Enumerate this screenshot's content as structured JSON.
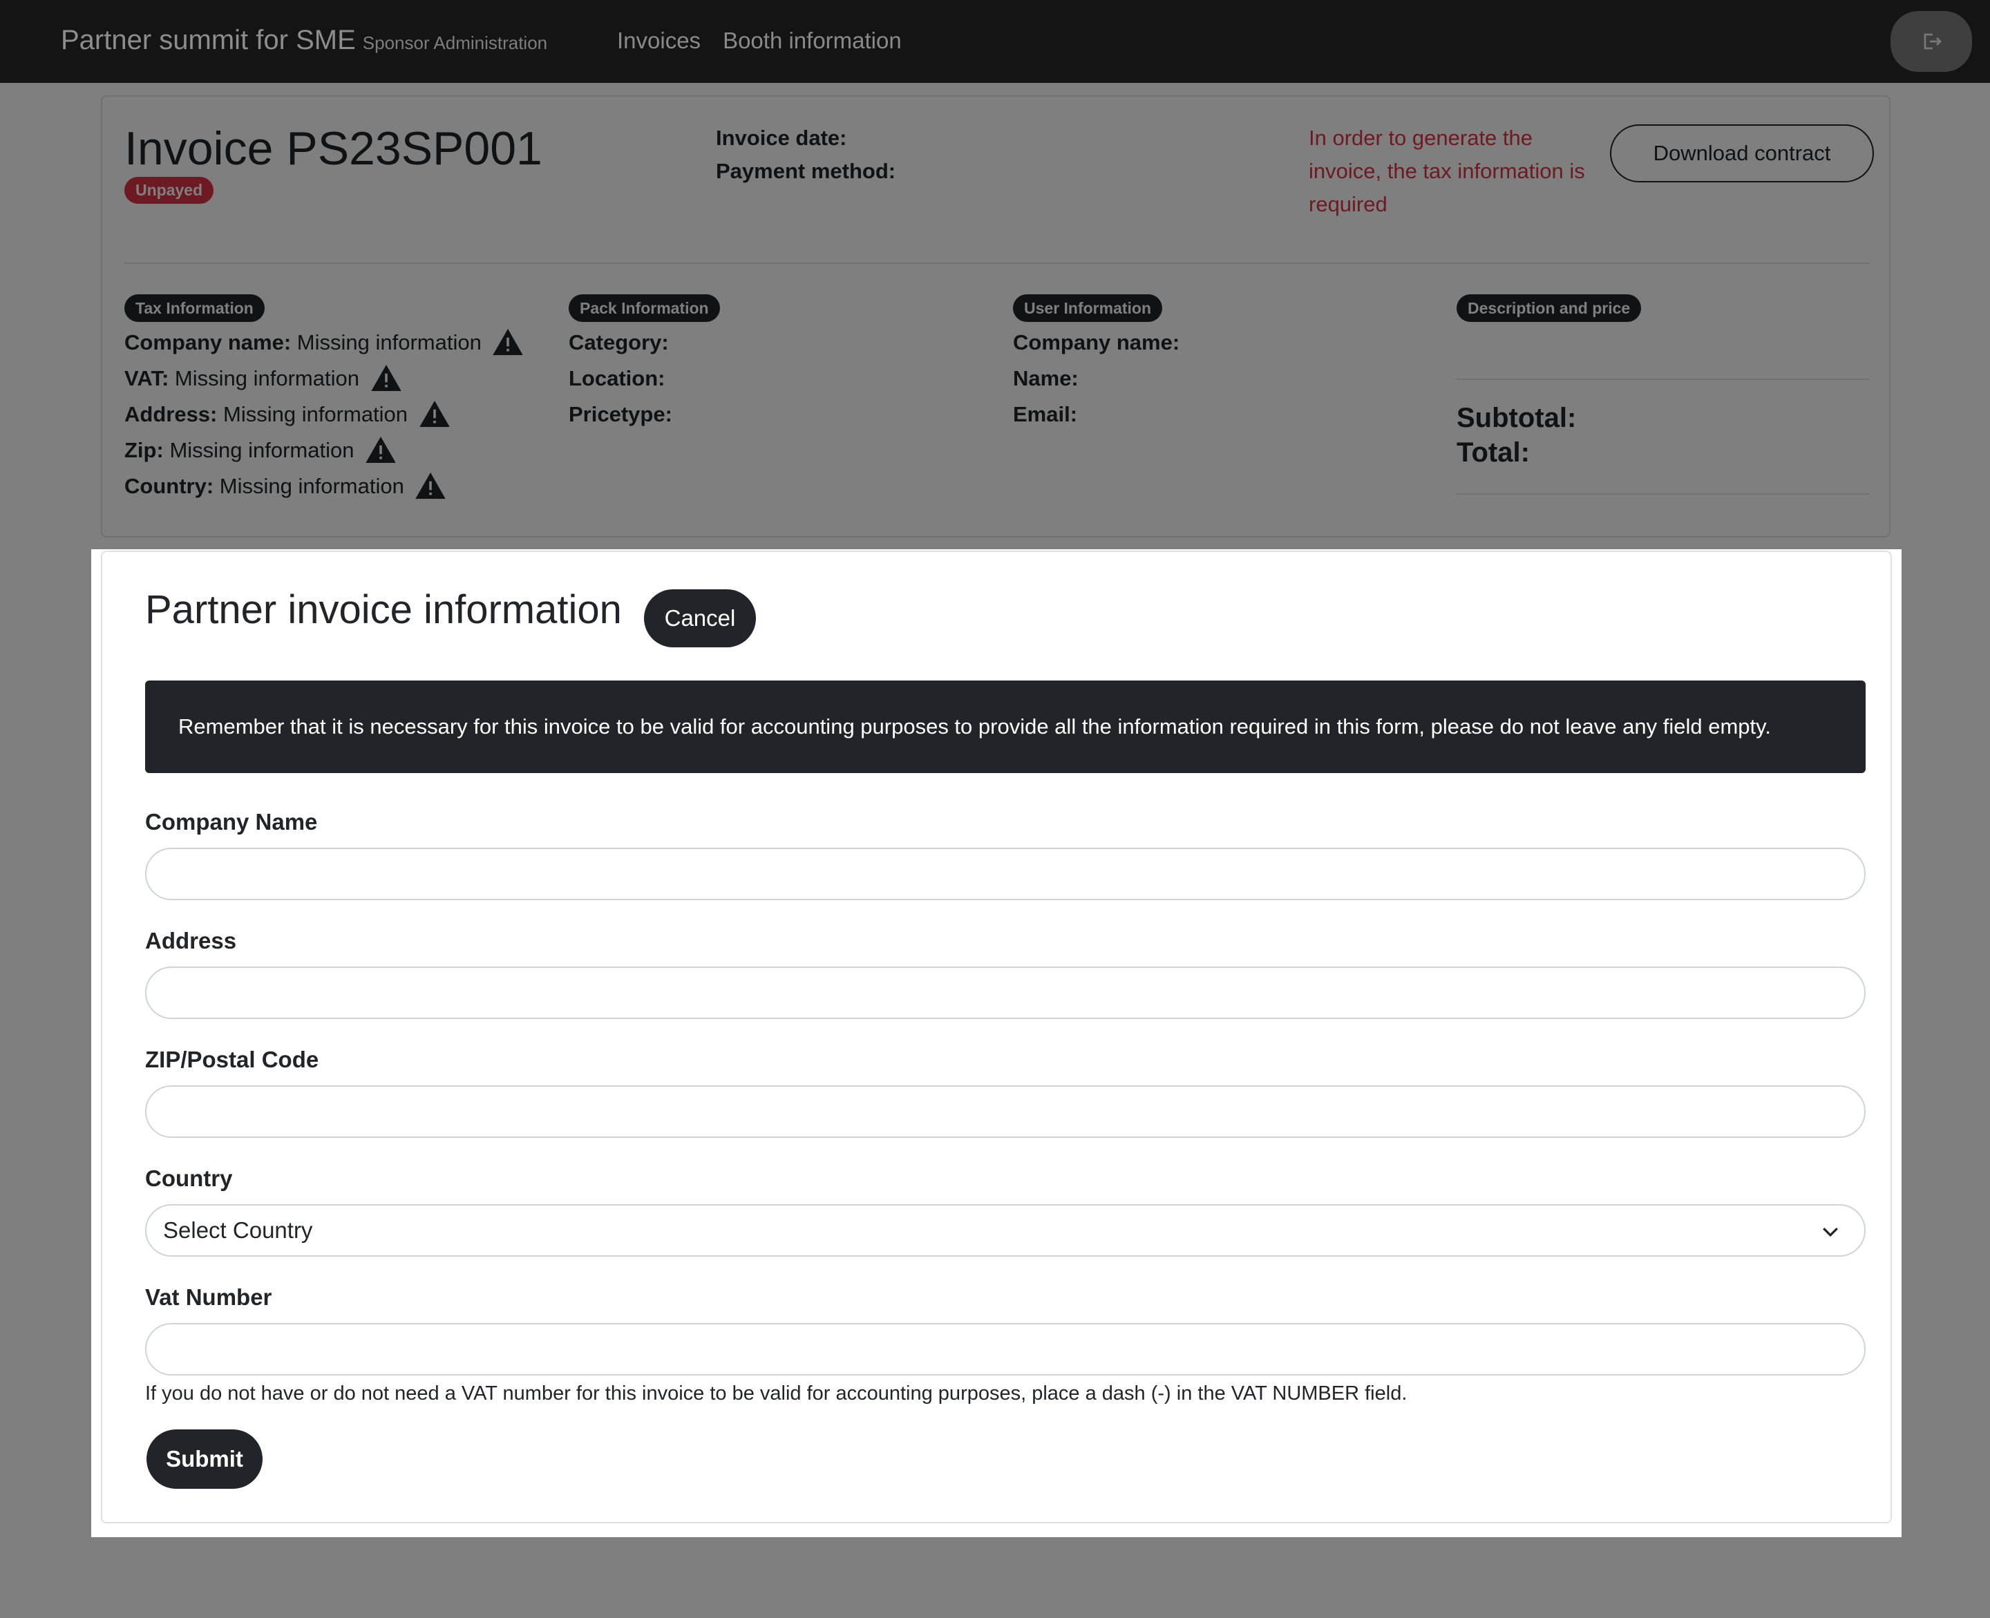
{
  "navbar": {
    "brand_title": "Partner summit for SME",
    "brand_subtitle": "Sponsor Administration",
    "links": [
      "Invoices",
      "Booth information"
    ],
    "logout_icon": "logout-icon"
  },
  "invoice": {
    "title": "Invoice PS23SP001",
    "status": "Unpayed",
    "invoice_date_label": "Invoice date:",
    "payment_method_label": "Payment method:",
    "warning": "In order to generate the invoice, the tax information is required",
    "download_label": "Download contract",
    "tax": {
      "badge": "Tax Information",
      "rows": [
        {
          "label": "Company name:",
          "value": "Missing information"
        },
        {
          "label": "VAT:",
          "value": "Missing information"
        },
        {
          "label": "Address:",
          "value": "Missing information"
        },
        {
          "label": "Zip:",
          "value": "Missing information"
        },
        {
          "label": "Country:",
          "value": "Missing information"
        }
      ]
    },
    "pack": {
      "badge": "Pack Information",
      "rows": [
        "Category:",
        "Location:",
        "Pricetype:"
      ]
    },
    "user": {
      "badge": "User Information",
      "rows": [
        "Company name:",
        "Name:",
        "Email:"
      ]
    },
    "price": {
      "badge": "Description and price",
      "subtotal_label": "Subtotal:",
      "total_label": "Total:"
    }
  },
  "modal": {
    "title": "Partner invoice information",
    "cancel_label": "Cancel",
    "alert": "Remember that it is necessary for this invoice to be valid for accounting purposes to provide all the information required in this form, please do not leave any field empty.",
    "fields": {
      "company_name": {
        "label": "Company Name",
        "value": ""
      },
      "address": {
        "label": "Address",
        "value": ""
      },
      "zip": {
        "label": "ZIP/Postal Code",
        "value": ""
      },
      "country": {
        "label": "Country",
        "selected": "Select Country"
      },
      "vat": {
        "label": "Vat Number",
        "value": ""
      }
    },
    "vat_help": "If you do not have or do not need a VAT number for this invoice to be valid for accounting purposes, place a dash (-) in the VAT NUMBER field.",
    "submit_label": "Submit"
  },
  "colors": {
    "dark": "#212529",
    "danger": "#dc3545",
    "navbar": "#141414"
  }
}
